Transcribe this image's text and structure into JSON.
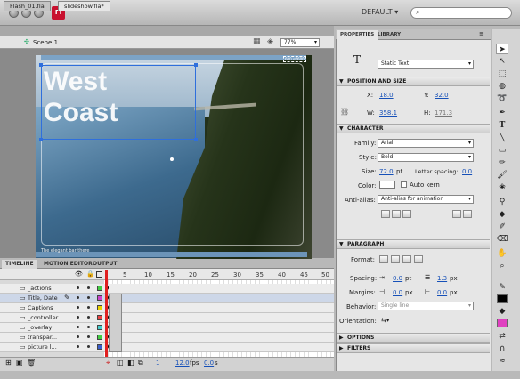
{
  "window": {
    "workspace": "DEFAULT ▾",
    "logo": "Fl"
  },
  "doc_tabs": [
    "Flash_01.fla",
    "slideshow.fla*"
  ],
  "edit_bar": {
    "scene": "Scene 1",
    "zoom": "77%"
  },
  "stage": {
    "headline_line1": "West",
    "headline_line2": "Coast",
    "caption": "The elegant bar there",
    "corner_label": "600 of 600"
  },
  "timeline": {
    "tabs": [
      "TIMELINE",
      "MOTION EDITOR",
      "OUTPUT"
    ],
    "frame_numbers": [
      "5",
      "10",
      "15",
      "20",
      "25",
      "30",
      "35",
      "40",
      "45",
      "50"
    ],
    "layers": [
      {
        "name": "_actions",
        "color": "#44cc44"
      },
      {
        "name": "Title, Date",
        "color": "#cc44cc"
      },
      {
        "name": "Captions",
        "color": "#e8d000"
      },
      {
        "name": "_controller",
        "color": "#ee4444"
      },
      {
        "name": "_overlay",
        "color": "#44cccc"
      },
      {
        "name": "transpar...",
        "color": "#44cc44"
      },
      {
        "name": "picture l...",
        "color": "#3a5fcc"
      }
    ],
    "footer": {
      "frame": "1",
      "fps": "12.0",
      "fps_unit": "fps",
      "time": "0.0",
      "time_unit": "s"
    }
  },
  "properties": {
    "tabs": [
      "PROPERTIES",
      "LIBRARY"
    ],
    "type_icon": "T",
    "text_type": "Static Text",
    "position_size": {
      "title": "POSITION AND SIZE",
      "x_label": "X:",
      "x": "18.0",
      "y_label": "Y:",
      "y": "32.0",
      "w_label": "W:",
      "w": "358.1",
      "h_label": "H:",
      "h": "171.3"
    },
    "character": {
      "title": "CHARACTER",
      "family_label": "Family:",
      "family": "Arial",
      "style_label": "Style:",
      "style": "Bold",
      "size_label": "Size:",
      "size": "72.0",
      "size_unit": "pt",
      "spacing_label": "Letter spacing:",
      "spacing": "0.0",
      "color_label": "Color:",
      "autokern": "Auto kern",
      "aa_label": "Anti-alias:",
      "aa": "Anti-alias for animation"
    },
    "paragraph": {
      "title": "PARAGRAPH",
      "format_label": "Format:",
      "spacing_label": "Spacing:",
      "spacing_indent": "0.0",
      "spacing_indent_unit": "pt",
      "spacing_line": "1.3",
      "spacing_line_unit": "px",
      "margins_label": "Margins:",
      "margin_left": "0.0",
      "margin_left_unit": "px",
      "margin_right": "0.0",
      "margin_right_unit": "px",
      "behavior_label": "Behavior:",
      "behavior": "Single line",
      "orientation_label": "Orientation:"
    },
    "options": "OPTIONS",
    "filters": "FILTERS"
  },
  "colors": {
    "accent": "#2f6fdc",
    "fill_color": "#e040c0",
    "stroke_color": "#000000"
  }
}
